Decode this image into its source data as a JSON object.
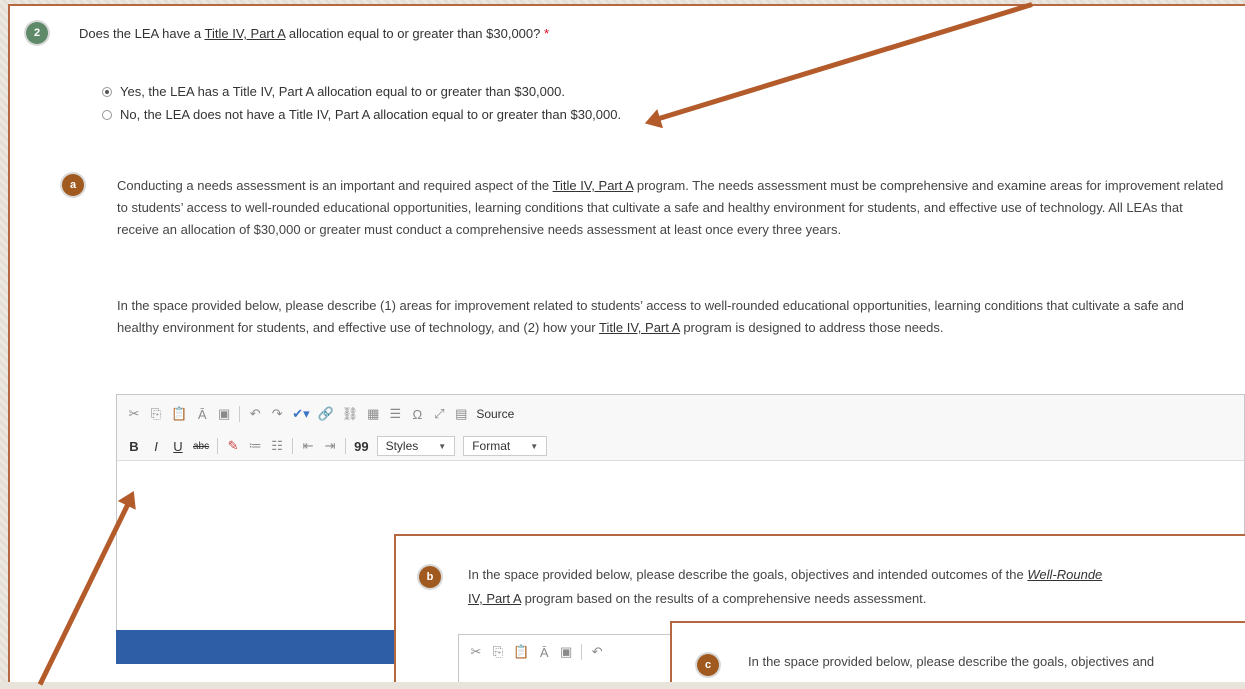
{
  "question2": {
    "number": "2",
    "text_before": "Does the LEA have a ",
    "link": "Title IV, Part A",
    "text_after": " allocation equal to or greater than $30,000?",
    "required_mark": "*",
    "options": [
      {
        "label": "Yes, the LEA has a Title IV, Part A allocation equal to or greater than $30,000.",
        "selected": true
      },
      {
        "label": "No, the LEA does not have a Title IV, Part A allocation equal to or greater than $30,000.",
        "selected": false
      }
    ]
  },
  "section_a": {
    "letter": "a",
    "p1_before": "Conducting a needs assessment is an important and required aspect of the ",
    "p1_link": "Title IV, Part A",
    "p1_after": " program. The needs assessment must be comprehensive and examine areas for improvement related to students’ access to well-rounded educational opportunities, learning conditions that cultivate a safe and healthy environment for students, and effective use of technology. All LEAs that receive an allocation of $30,000 or greater must conduct a comprehensive needs assessment at least once every three years.",
    "p2_before": "In the space provided below, please describe (1) areas for improvement related to students’ access to well-rounded educational opportunities, learning conditions that cultivate a safe and healthy environment for students, and effective use of technology, and (2) how your ",
    "p2_link": "Title IV, Part A",
    "p2_after": " program is designed to address those needs."
  },
  "editor": {
    "source_label": "Source",
    "styles_label": "Styles",
    "format_label": "Format",
    "bold": "B",
    "italic": "I",
    "underline": "U",
    "strike": "abc",
    "quote": "99"
  },
  "section_b": {
    "letter": "b",
    "line1_before": "In the space provided below, please describe the goals, objectives and intended outcomes of the ",
    "line1_link": "Well-Rounde",
    "line2_link": "IV, Part A",
    "line2_after": " program based on the results of a comprehensive needs assessment."
  },
  "section_c": {
    "letter": "c",
    "text": "In the space provided below, please describe the goals, objectives and"
  },
  "colors": {
    "panel_border": "#b5673f",
    "arrow": "#b35b2b",
    "badge_green": "#5f8a6a",
    "badge_brown": "#a05a1f",
    "editor_bar": "#2e5ea6"
  }
}
